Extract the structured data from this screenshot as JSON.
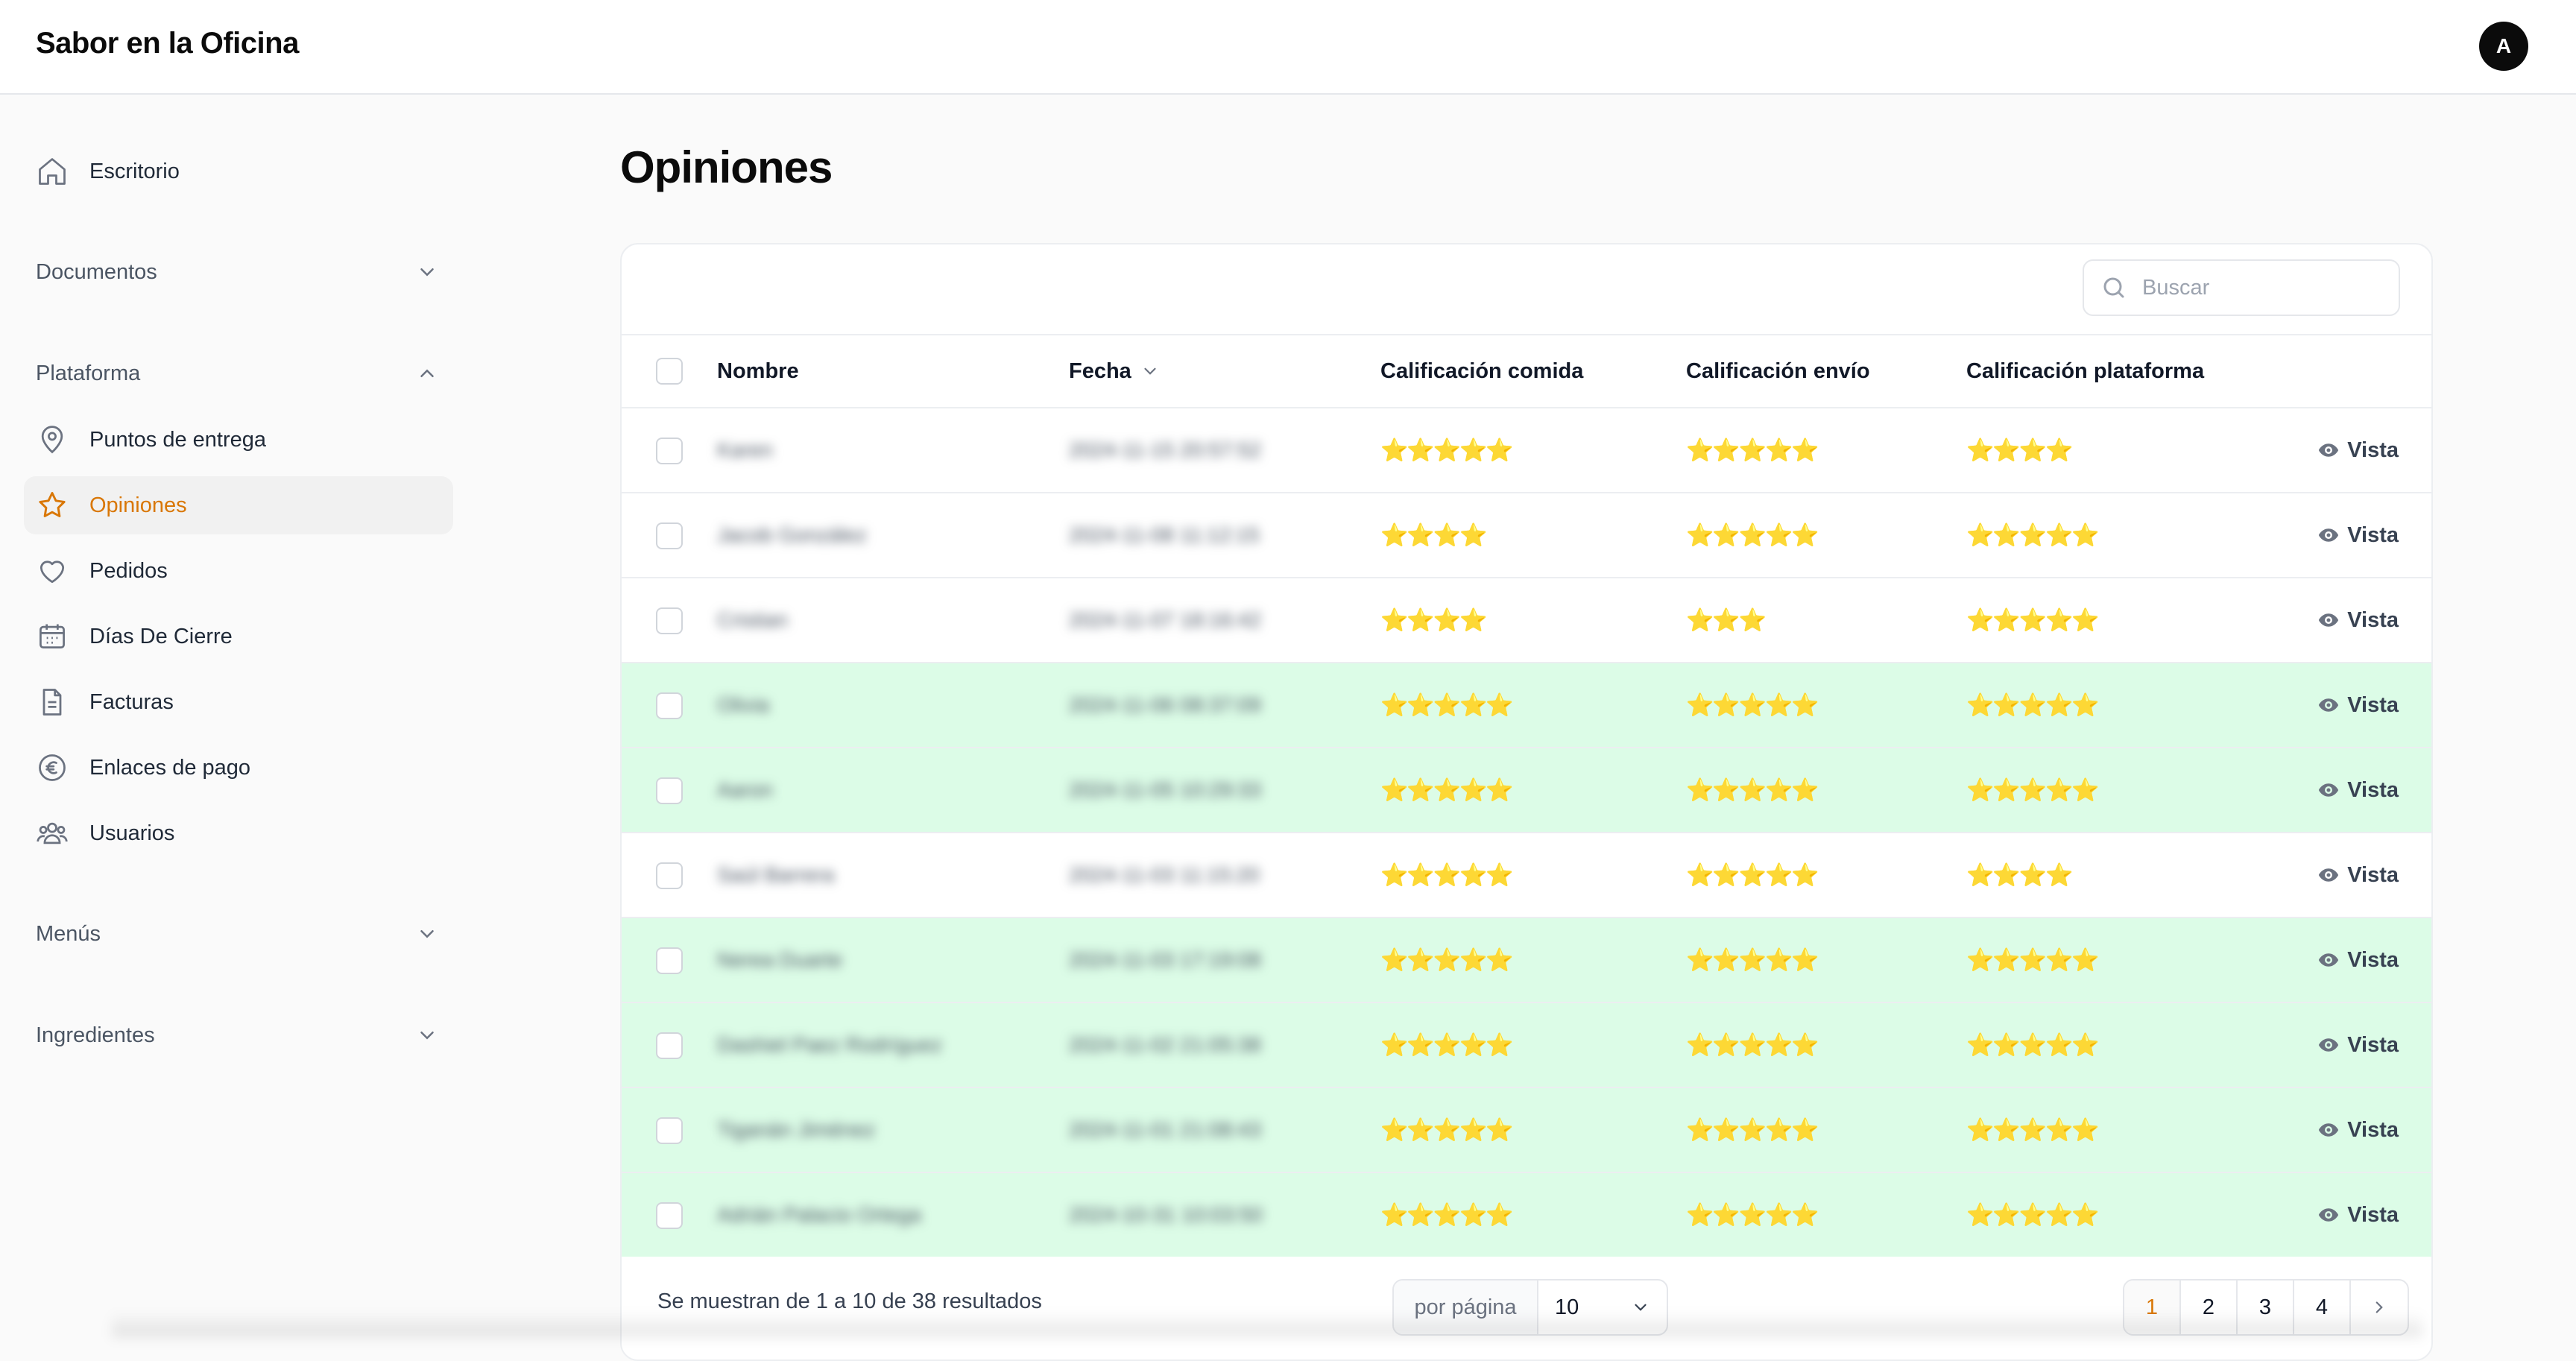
{
  "app": {
    "brand": "Sabor en la Oficina",
    "avatar_initial": "A"
  },
  "sidebar": {
    "top_item": {
      "label": "Escritorio",
      "icon": "home-icon"
    },
    "groups": [
      {
        "label": "Documentos",
        "expanded": false
      },
      {
        "label": "Plataforma",
        "expanded": true
      },
      {
        "label": "Menús",
        "expanded": false
      },
      {
        "label": "Ingredientes",
        "expanded": false
      }
    ],
    "platform_items": [
      {
        "label": "Puntos de entrega",
        "icon": "map-pin-icon"
      },
      {
        "label": "Opiniones",
        "icon": "star-icon",
        "active": true
      },
      {
        "label": "Pedidos",
        "icon": "heart-icon"
      },
      {
        "label": "Días De Cierre",
        "icon": "calendar-icon"
      },
      {
        "label": "Facturas",
        "icon": "document-icon"
      },
      {
        "label": "Enlaces de pago",
        "icon": "euro-icon"
      },
      {
        "label": "Usuarios",
        "icon": "users-icon"
      }
    ]
  },
  "page": {
    "title": "Opiniones"
  },
  "search": {
    "placeholder": "Buscar"
  },
  "table": {
    "columns": [
      "Nombre",
      "Fecha",
      "Calificación comida",
      "Calificación envío",
      "Calificación plataforma"
    ],
    "sort_column": "Fecha",
    "action_label": "Vista",
    "rows": [
      {
        "name": "Karen",
        "date": "2024-11-15 20:57:52",
        "food": "⭐⭐⭐⭐⭐",
        "delivery": "⭐⭐⭐⭐⭐",
        "platform": "⭐⭐⭐⭐",
        "highlight": false
      },
      {
        "name": "Jacob González",
        "date": "2024-11-08 11:12:15",
        "food": "⭐⭐⭐⭐",
        "delivery": "⭐⭐⭐⭐⭐",
        "platform": "⭐⭐⭐⭐⭐",
        "highlight": false
      },
      {
        "name": "Cristian",
        "date": "2024-11-07 18:16:42",
        "food": "⭐⭐⭐⭐",
        "delivery": "⭐⭐⭐",
        "platform": "⭐⭐⭐⭐⭐",
        "highlight": false
      },
      {
        "name": "Olivia",
        "date": "2024-11-06 08:37:09",
        "food": "⭐⭐⭐⭐⭐",
        "delivery": "⭐⭐⭐⭐⭐",
        "platform": "⭐⭐⭐⭐⭐",
        "highlight": true
      },
      {
        "name": "Aaron",
        "date": "2024-11-05 10:29:33",
        "food": "⭐⭐⭐⭐⭐",
        "delivery": "⭐⭐⭐⭐⭐",
        "platform": "⭐⭐⭐⭐⭐",
        "highlight": true
      },
      {
        "name": "Saúl Barrera",
        "date": "2024-11-03 11:15:20",
        "food": "⭐⭐⭐⭐⭐",
        "delivery": "⭐⭐⭐⭐⭐",
        "platform": "⭐⭐⭐⭐",
        "highlight": false
      },
      {
        "name": "Nerea Duarte",
        "date": "2024-11-03 17:19:08",
        "food": "⭐⭐⭐⭐⭐",
        "delivery": "⭐⭐⭐⭐⭐",
        "platform": "⭐⭐⭐⭐⭐",
        "highlight": true
      },
      {
        "name": "Dashiel Paez Rodríguez",
        "date": "2024-11-02 21:05:38",
        "food": "⭐⭐⭐⭐⭐",
        "delivery": "⭐⭐⭐⭐⭐",
        "platform": "⭐⭐⭐⭐⭐",
        "highlight": true
      },
      {
        "name": "Tiganán Jiménez",
        "date": "2024-11-01 21:08:43",
        "food": "⭐⭐⭐⭐⭐",
        "delivery": "⭐⭐⭐⭐⭐",
        "platform": "⭐⭐⭐⭐⭐",
        "highlight": true
      },
      {
        "name": "Adrián Palacio Ortega",
        "date": "2024-10-31 10:03:50",
        "food": "⭐⭐⭐⭐⭐",
        "delivery": "⭐⭐⭐⭐⭐",
        "platform": "⭐⭐⭐⭐⭐",
        "highlight": true
      }
    ]
  },
  "footer": {
    "results_text": "Se muestran de 1 a 10 de 38 resultados",
    "per_page_label": "por página",
    "per_page_value": "10",
    "pages": [
      "1",
      "2",
      "3",
      "4"
    ],
    "current_page": "1"
  },
  "colors": {
    "accent": "#d97706",
    "highlight_row": "#dcfce7",
    "star": "#f5b800"
  }
}
